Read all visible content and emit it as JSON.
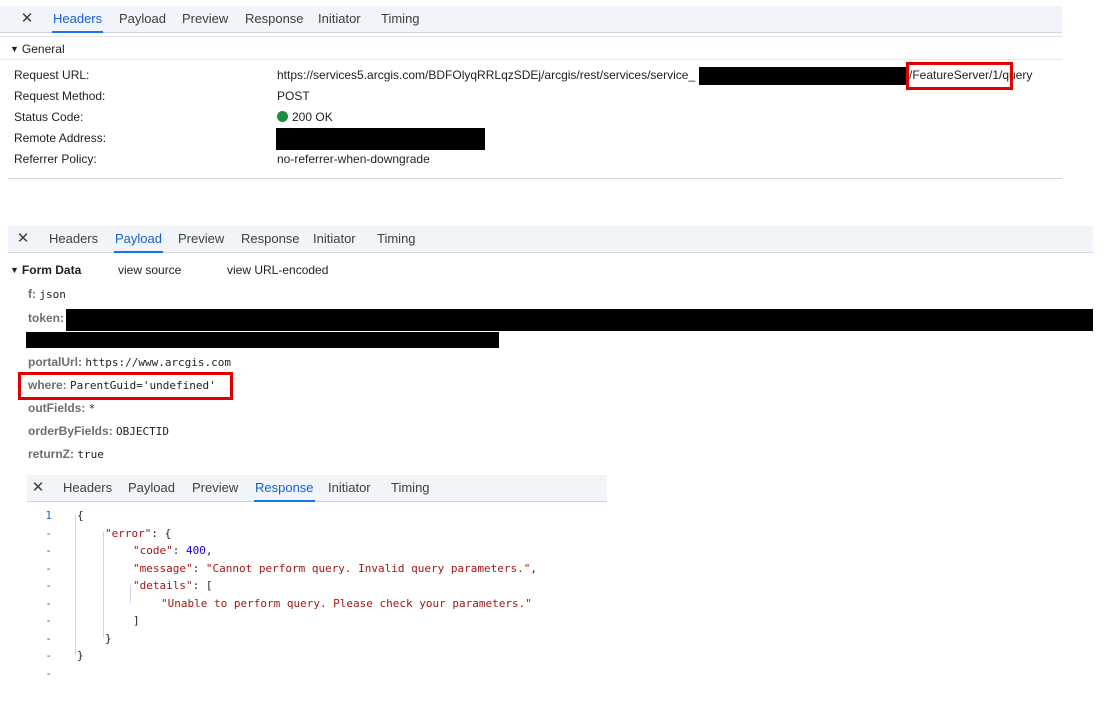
{
  "tabs": [
    "Headers",
    "Payload",
    "Preview",
    "Response",
    "Initiator",
    "Timing"
  ],
  "close_glyph": "✕",
  "headers_panel": {
    "active_tab": "Headers",
    "general_title": "General",
    "rows": [
      {
        "label": "Request URL:",
        "value": "https://services5.arcgis.com/BDFOlyqRRLqzSDEj/arcgis/rest/services/service_",
        "value_tail": "/FeatureServer/1/query"
      },
      {
        "label": "Request Method:",
        "value": "POST"
      },
      {
        "label": "Status Code:",
        "value": "200 OK",
        "status_color": "#1e8e3e"
      },
      {
        "label": "Remote Address:",
        "value": ""
      },
      {
        "label": "Referrer Policy:",
        "value": "no-referrer-when-downgrade"
      }
    ]
  },
  "payload_panel": {
    "active_tab": "Payload",
    "form_data_title": "Form Data",
    "view_source": "view source",
    "view_url_encoded": "view URL-encoded",
    "fields": [
      {
        "key": "f:",
        "value": "json"
      },
      {
        "key": "token:",
        "value": ""
      },
      {
        "key": "portalUrl:",
        "value": "https://www.arcgis.com"
      },
      {
        "key": "where:",
        "value": "ParentGuid='undefined'"
      },
      {
        "key": "outFields:",
        "value": "*"
      },
      {
        "key": "orderByFields:",
        "value": "OBJECTID"
      },
      {
        "key": "returnZ:",
        "value": "true"
      }
    ]
  },
  "response_panel": {
    "active_tab": "Response",
    "gutter": [
      "1",
      "-",
      "-",
      "-",
      "-",
      "-",
      "-",
      "-",
      "-",
      "-"
    ],
    "lines": [
      {
        "parts": [
          {
            "t": "punc",
            "v": "{"
          }
        ]
      },
      {
        "parts": [
          {
            "t": "key",
            "v": "\"error\""
          },
          {
            "t": "punc",
            "v": ": {"
          }
        ]
      },
      {
        "parts": [
          {
            "t": "key",
            "v": "\"code\""
          },
          {
            "t": "punc",
            "v": ": "
          },
          {
            "t": "num",
            "v": "400"
          },
          {
            "t": "punc",
            "v": ","
          }
        ]
      },
      {
        "parts": [
          {
            "t": "key",
            "v": "\"message\""
          },
          {
            "t": "punc",
            "v": ": "
          },
          {
            "t": "str",
            "v": "\"Cannot perform query. Invalid query parameters.\""
          },
          {
            "t": "punc",
            "v": ","
          }
        ]
      },
      {
        "parts": [
          {
            "t": "key",
            "v": "\"details\""
          },
          {
            "t": "punc",
            "v": ": ["
          }
        ]
      },
      {
        "parts": [
          {
            "t": "str",
            "v": "\"Unable to perform query. Please check your parameters.\""
          }
        ]
      },
      {
        "parts": [
          {
            "t": "punc",
            "v": "]"
          }
        ]
      },
      {
        "parts": [
          {
            "t": "punc",
            "v": "}"
          }
        ]
      },
      {
        "parts": [
          {
            "t": "punc",
            "v": "}"
          }
        ]
      }
    ]
  },
  "colors": {
    "accent": "#1a73e8",
    "highlight_box": "#e00000",
    "status_ok": "#1e8e3e",
    "json_key": "#a31515",
    "json_number": "#1c00cf"
  }
}
